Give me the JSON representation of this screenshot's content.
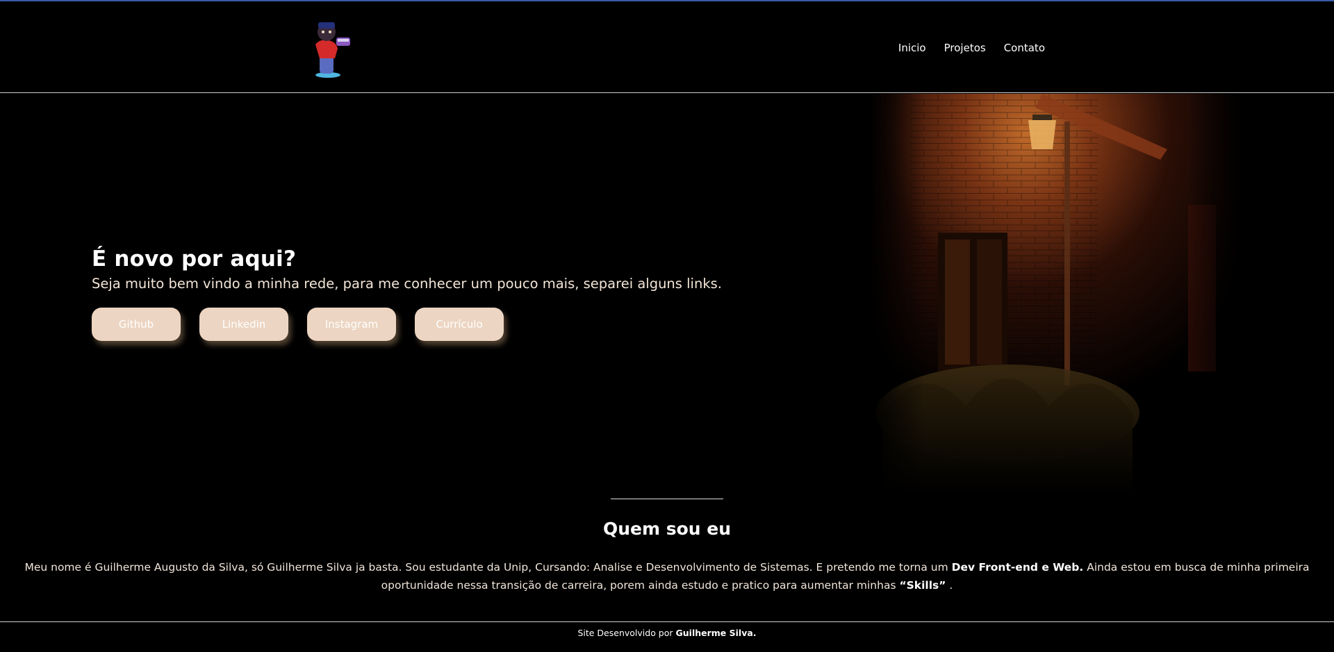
{
  "nav": {
    "items": [
      {
        "label": "Inicio"
      },
      {
        "label": "Projetos"
      },
      {
        "label": "Contato"
      }
    ]
  },
  "hero": {
    "title": "É novo por aqui?",
    "subtitle": "Seja muito bem vindo a minha rede, para me conhecer um pouco mais, separei alguns links.",
    "buttons": [
      {
        "label": "Github"
      },
      {
        "label": "Linkedin"
      },
      {
        "label": "Instagram"
      },
      {
        "label": "Currículo"
      }
    ]
  },
  "about": {
    "title": "Quem sou eu",
    "text_part1": "Meu nome é Guilherme Augusto da Silva, só Guilherme Silva ja basta. Sou estudante da Unip, Cursando: Analise e Desenvolvimento de Sistemas. E pretendo me torna um ",
    "text_bold1": "Dev Front-end e Web.",
    "text_part2": " Ainda estou em busca de minha primeira oportunidade nessa transição de carreira, porem ainda estudo e pratico para aumentar minhas ",
    "text_bold2": "“Skills”",
    "text_part3": " ."
  },
  "footer": {
    "prefix": "Site Desenvolvido por ",
    "author": "Guilherme Silva."
  },
  "colors": {
    "background": "#000000",
    "button_bg": "#ecd5c2",
    "text": "#f1e6da",
    "accent_line": "#3a5aa8"
  }
}
